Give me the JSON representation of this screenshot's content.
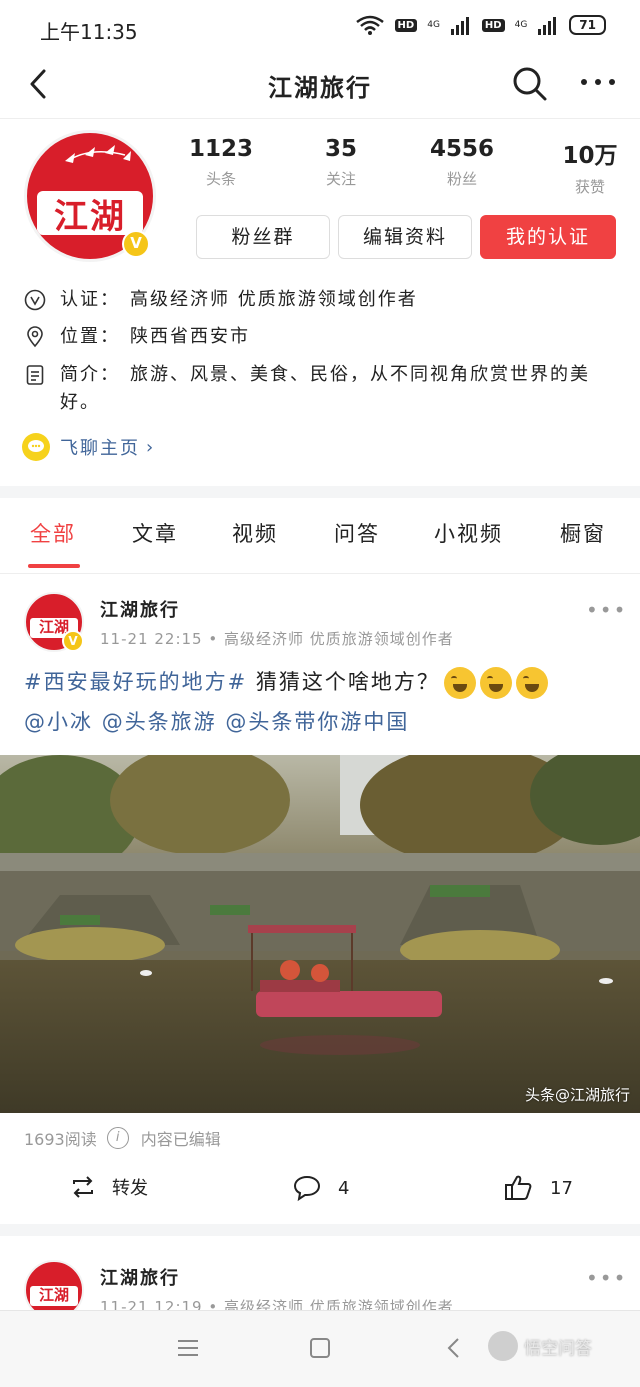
{
  "status_bar": {
    "time": "上午11:35",
    "hd1": "HD",
    "net1": "4G",
    "hd2": "HD",
    "net2": "4G",
    "battery": "71"
  },
  "nav": {
    "title": "江湖旅行",
    "back_icon": "chevron-left-icon",
    "search_icon": "search-icon",
    "more_icon": "more-horizontal-icon"
  },
  "profile": {
    "avatar_text": "江湖",
    "verified_badge": "V",
    "stats": [
      {
        "value": "1123",
        "label": "头条"
      },
      {
        "value": "35",
        "label": "关注"
      },
      {
        "value": "4556",
        "label": "粉丝"
      },
      {
        "value": "10万",
        "label": "获赞"
      }
    ],
    "buttons": {
      "fans_group": "粉丝群",
      "edit_profile": "编辑资料",
      "my_verification": "我的认证"
    },
    "verification_label": "认证：",
    "verification_text": "高级经济师 优质旅游领域创作者",
    "location_label": "位置：",
    "location_text": "陕西省西安市",
    "bio_label": "简介：",
    "bio_text": "旅游、风景、美食、民俗，从不同视角欣赏世界的美好。",
    "feiliao_link": "飞聊主页"
  },
  "tabs": [
    {
      "label": "全部",
      "active": true
    },
    {
      "label": "文章",
      "active": false
    },
    {
      "label": "视频",
      "active": false
    },
    {
      "label": "问答",
      "active": false
    },
    {
      "label": "小视频",
      "active": false
    },
    {
      "label": "橱窗",
      "active": false
    }
  ],
  "posts": [
    {
      "author": "江湖旅行",
      "meta": "11-21 22:15 • 高级经济师 优质旅游领域创作者",
      "hashtag": "#西安最好玩的地方#",
      "text": " 猜猜这个啥地方？",
      "emojis": [
        "😂",
        "😂",
        "😂"
      ],
      "mentions": [
        "@小冰",
        "@头条旅游",
        "@头条带你游中国"
      ],
      "photo_watermark": "头条@江湖旅行",
      "reads": "1693阅读",
      "edited": "内容已编辑",
      "actions": {
        "repost": "转发",
        "comments": "4",
        "likes": "17"
      }
    },
    {
      "author": "江湖旅行",
      "meta": "11-21 12:19 • 高级经济师 优质旅游领域创作者"
    }
  ],
  "system_nav": {
    "menu_icon": "menu-icon",
    "home_icon": "home-square-icon",
    "back_icon": "back-triangle-icon"
  },
  "watermark": "悟空问答",
  "colors": {
    "accent_red": "#f04142",
    "link_blue": "#406599",
    "brand_red": "#d81e2a",
    "badge_yellow": "#f5c518"
  }
}
